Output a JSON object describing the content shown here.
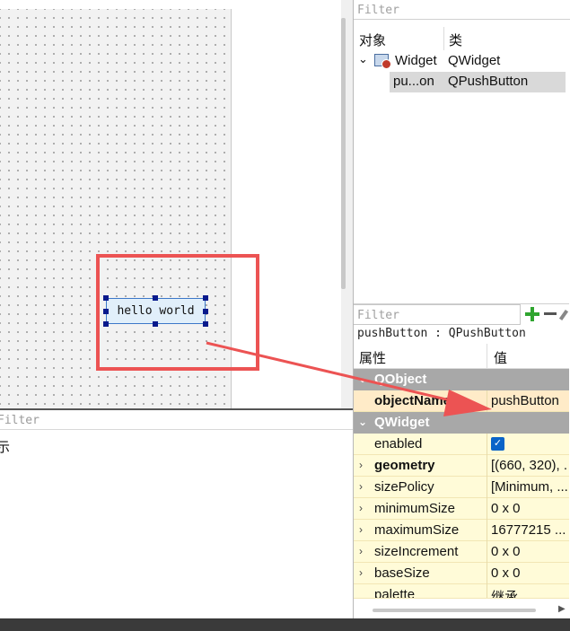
{
  "canvas": {
    "push_button_text": "hello world"
  },
  "bottom_left": {
    "filter_placeholder": "Filter",
    "text": "示"
  },
  "object_inspector": {
    "filter_placeholder": "Filter",
    "col_object": "对象",
    "col_class": "类",
    "rows": [
      {
        "name": "Widget",
        "class": "QWidget",
        "icon": "widget-icon"
      },
      {
        "name": "pu...on",
        "class": "QPushButton"
      }
    ]
  },
  "property_editor": {
    "filter_placeholder": "Filter",
    "class_line": "pushButton : QPushButton",
    "col_property": "属性",
    "col_value": "值",
    "categories": [
      {
        "name": "QObject",
        "rows": [
          {
            "name": "objectName",
            "value": "pushButton"
          }
        ]
      },
      {
        "name": "QWidget",
        "rows": [
          {
            "name": "enabled",
            "value": "checked"
          },
          {
            "name": "geometry",
            "value": "[(660, 320), ..."
          },
          {
            "name": "sizePolicy",
            "value": "[Minimum, ..."
          },
          {
            "name": "minimumSize",
            "value": "0 x 0"
          },
          {
            "name": "maximumSize",
            "value": "16777215 ..."
          },
          {
            "name": "sizeIncrement",
            "value": "0 x 0"
          },
          {
            "name": "baseSize",
            "value": "0 x 0"
          },
          {
            "name": "palette",
            "value": "继承"
          }
        ]
      }
    ]
  },
  "colors": {
    "annotation_red": "#ec5353",
    "selection_blue": "#0a1a8c",
    "category_gray": "#a8a8a8",
    "row_yellow": "#fffbd8"
  }
}
